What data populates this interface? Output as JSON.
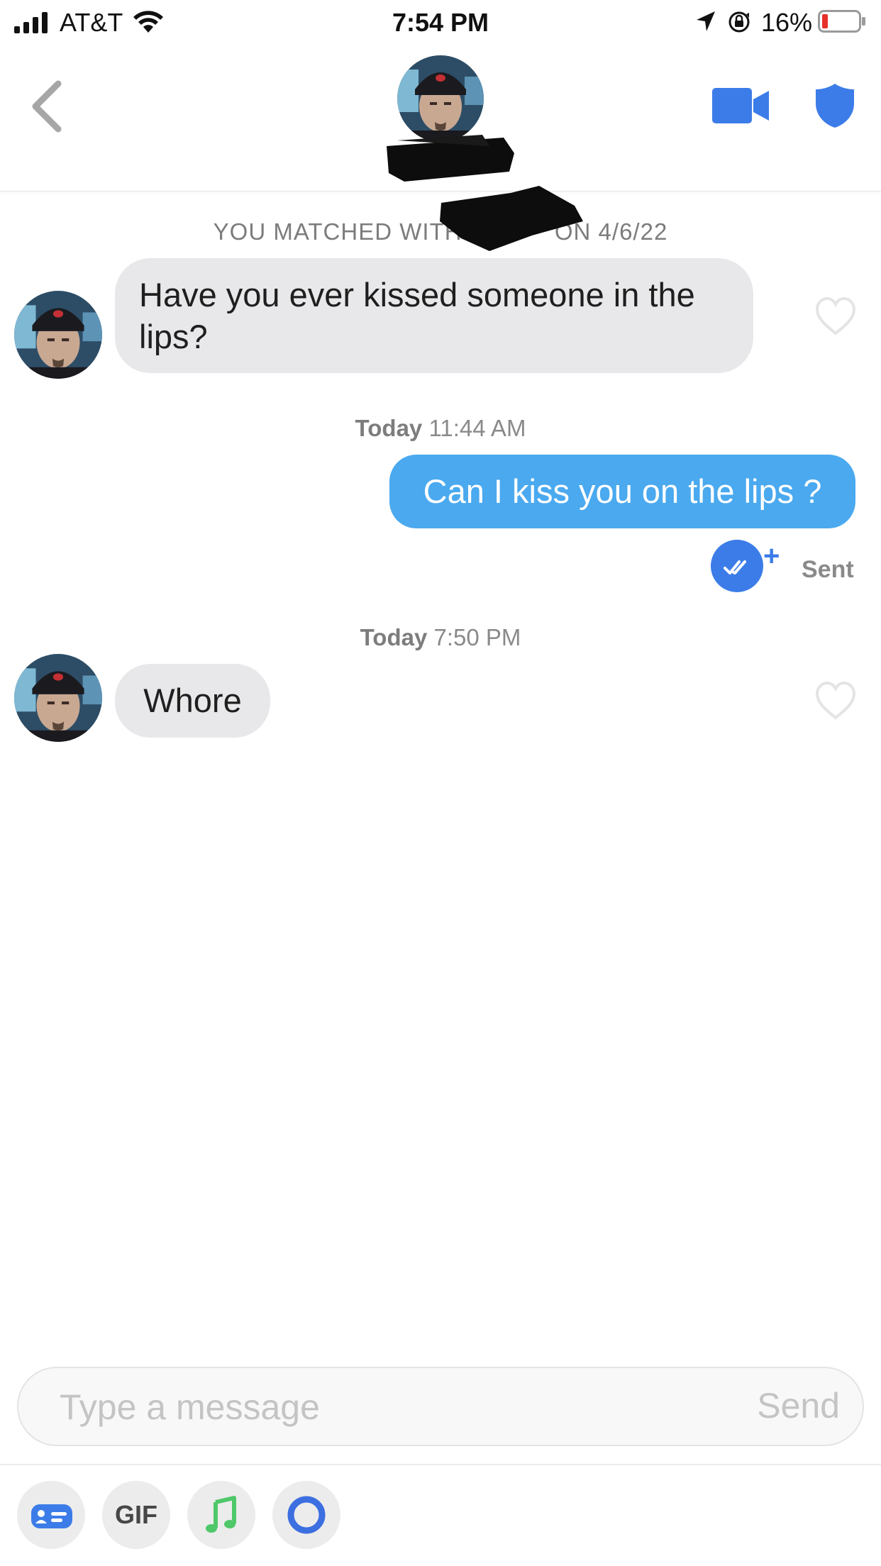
{
  "status_bar": {
    "carrier": "AT&T",
    "time": "7:54 PM",
    "battery_percent": "16%"
  },
  "header": {
    "back_icon": "chevron-left-icon",
    "video_icon": "video-camera-icon",
    "safety_icon": "shield-icon"
  },
  "match": {
    "text_prefix": "YOU MATCHED WITH",
    "text_suffix": "ON 4/6/22"
  },
  "messages": [
    {
      "direction": "in",
      "text": "Have you ever kissed someone in the lips?"
    },
    {
      "timestamp_day": "Today",
      "timestamp_time": "11:44 AM"
    },
    {
      "direction": "out",
      "text": "Can I kiss you on the lips ?",
      "status": "Sent"
    },
    {
      "timestamp_day": "Today",
      "timestamp_time": "7:50 PM"
    },
    {
      "direction": "in",
      "text": "Whore"
    }
  ],
  "composer": {
    "placeholder": "Type a message",
    "send_label": "Send"
  },
  "toolbar": {
    "gif_label": "GIF",
    "items": [
      "contact-card-icon",
      "gif-button",
      "music-note-icon",
      "ring-icon"
    ]
  },
  "colors": {
    "outgoing_bubble": "#4aa9ef",
    "incoming_bubble": "#e8e8ea",
    "accent_blue": "#3c7ce8"
  }
}
